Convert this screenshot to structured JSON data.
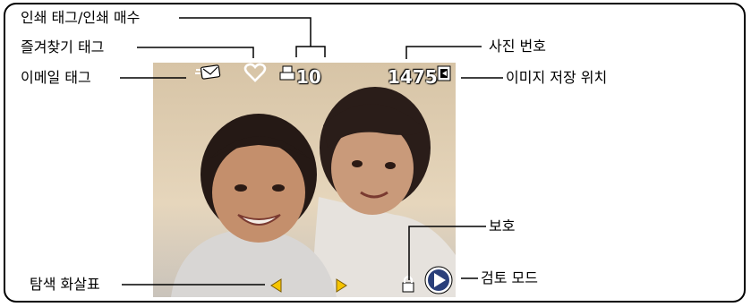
{
  "labels": {
    "print_tag": "인쇄 태그/인쇄 매수",
    "favorite_tag": "즐겨찾기 태그",
    "email_tag": "이메일 태그",
    "picture_number": "사진 번호",
    "image_storage": "이미지 저장 위치",
    "protect": "보호",
    "scroll_arrows": "탐색 화살표",
    "review_mode": "검토 모드"
  },
  "overlay": {
    "print_count": "10",
    "picture_number": "1475"
  },
  "icons": [
    "email-icon",
    "heart-icon",
    "print-icon",
    "storage-icon",
    "lock-icon",
    "left-arrow-icon",
    "right-arrow-icon",
    "play-icon"
  ],
  "colors": {
    "arrow": "#f5c400",
    "overlay_text": "#ffffff",
    "callout": "#000000"
  }
}
